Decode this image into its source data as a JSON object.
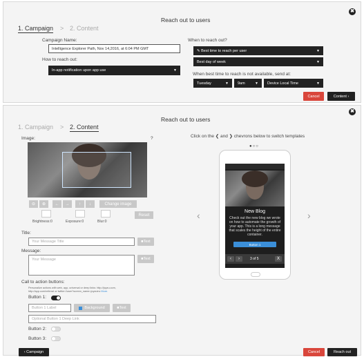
{
  "top": {
    "title": "Reach out to users",
    "close": "✖",
    "step1": "1. Campaign",
    "sep": ">",
    "step2": "2. Content",
    "campaign_name_label": "Campaign Name:",
    "campaign_name_value": "Intelligence Explorer Path, Nov 14,2016, at 6:04 PM GMT",
    "how_label": "How to reach out:",
    "how_value": "In-app notification upon app use",
    "when_label": "When to reach out?",
    "when_value": "Best time to reach per user",
    "best_day": "Best day of week",
    "fallback_label": "When best time to reach is not available, send at:",
    "day": "Tuesday",
    "time": "9am",
    "tz": "Device Local Time",
    "cancel": "Cancel",
    "content": "Content ›"
  },
  "bottom": {
    "title": "Reach out to users",
    "close": "✖",
    "step1": "1. Campaign",
    "sep": ">",
    "step2": "2. Content",
    "image_label": "Image:",
    "help": "?",
    "tools": [
      "⊖",
      "⊕",
      "←",
      "→",
      "↑",
      "↓"
    ],
    "change_image": "Change image",
    "reset": "Reset",
    "brightness": "Brightness:0",
    "exposure": "Exposure:0",
    "blur": "Blur:0",
    "title_label": "Title:",
    "title_ph": "Your Message Title",
    "text_btn": "Text",
    "message_label": "Message:",
    "message_ph": "Your Message",
    "cta_label": "Call to action buttons:",
    "cta_help1": "Personalize actions with web, app, universal or deep links: http://joyzu.com,",
    "cta_help2": "http://app.com/referral or twitter://user?screen_name=joyzuinc",
    "cta_more": "More.",
    "button1": "Button 1:",
    "button1_ph": "Button 1 Label",
    "background": "Background",
    "deeplink_ph": "Optional Button 1 Deep Link",
    "button2": "Button 2:",
    "button3": "Button 3:",
    "campaign_back": "‹ Campaign",
    "cancel": "Cancel",
    "reach_out": "Reach out",
    "instruction": "Click on the ❮ and ❯ chevrons below to switch templates",
    "prev": "‹",
    "next": "›",
    "preview": {
      "blog_title": "New Blog",
      "blog_body": "Check out the new blog we wrote on how to automate the growth of your app. This is a long message that scales the height of the entire container.",
      "blog_button": "Button 1",
      "pager": "3 of 5",
      "close": "X",
      "back": "‹",
      "fwd": "›"
    }
  },
  "colors": {
    "red": "#d9463b",
    "blue": "#3b8fd9",
    "dark": "#222222"
  }
}
